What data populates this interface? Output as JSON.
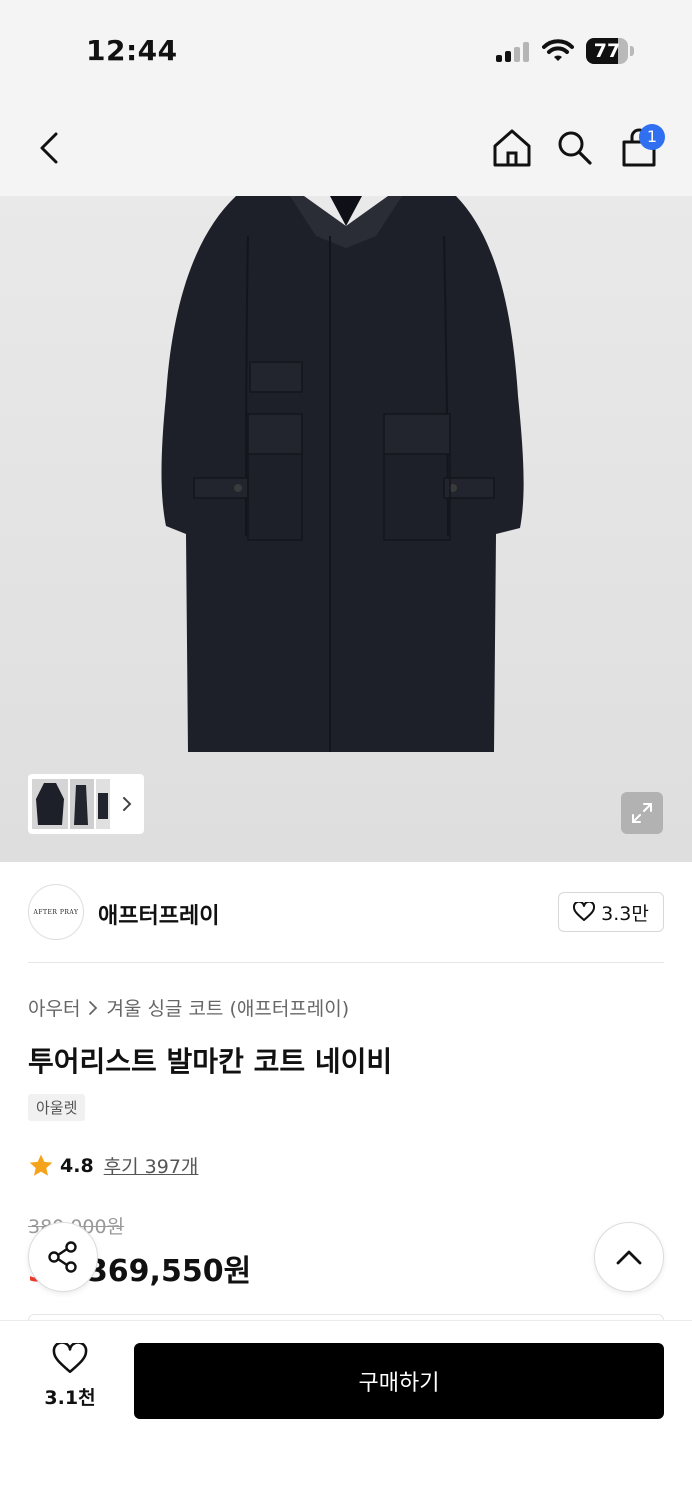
{
  "status_bar": {
    "time": "12:44",
    "battery": "77",
    "battery_level": 0.77
  },
  "nav": {
    "back_icon": "chevron-left-icon",
    "home_icon": "home-icon",
    "search_icon": "search-icon",
    "cart_icon": "shopping-bag-icon",
    "cart_count": "1"
  },
  "brand": {
    "logo_text": "AFTER PRAY",
    "name": "애프터프레이",
    "likes": "3.3만"
  },
  "product": {
    "breadcrumb": [
      "아우터",
      "겨울 싱글 코트 (애프터프레이)"
    ],
    "title": "투어리스트 발마칸 코트 네이비",
    "tag": "아울렛",
    "rating": "4.8",
    "reviews": "후기 397개",
    "original_price": "380,000원",
    "discount": "3%",
    "sale_price": "369,550원"
  },
  "bottom_bar": {
    "wish_count": "3.1천",
    "buy_label": "구매하기"
  },
  "colors": {
    "accent_blue": "#2f6ff0",
    "discount_red": "#ef3b2f",
    "star": "#f5a31a",
    "coat": "#1d1f29"
  }
}
